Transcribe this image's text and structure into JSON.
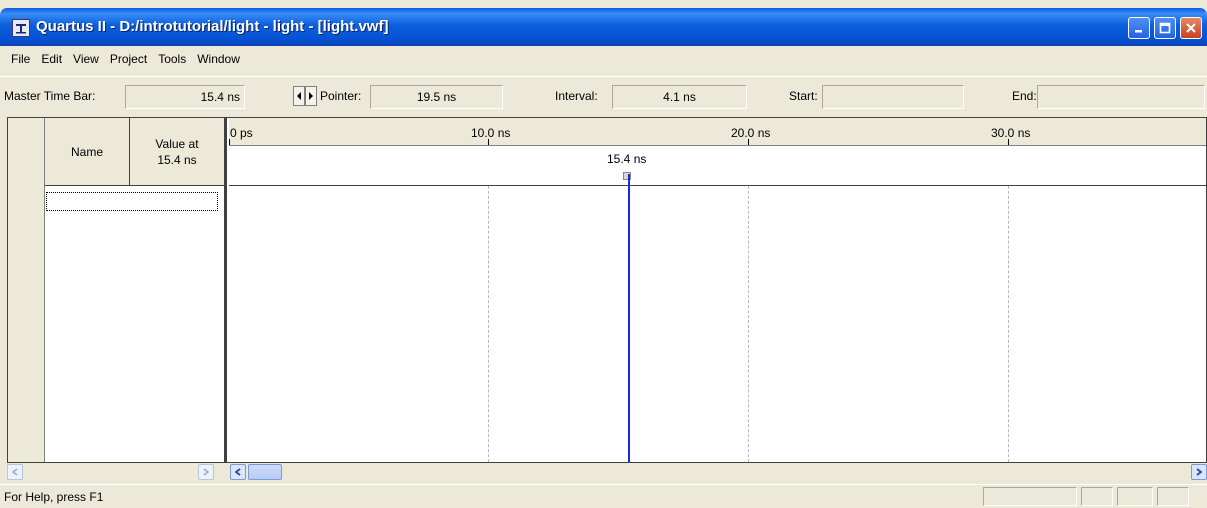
{
  "window": {
    "title": "Quartus II - D:/introtutorial/light - light - [light.vwf]"
  },
  "menu": [
    "File",
    "Edit",
    "View",
    "Project",
    "Tools",
    "Window"
  ],
  "timebar": {
    "master_label": "Master Time Bar:",
    "master_value": "15.4 ns",
    "pointer_label": "Pointer:",
    "pointer_value": "19.5 ns",
    "interval_label": "Interval:",
    "interval_value": "4.1 ns",
    "start_label": "Start:",
    "start_value": "",
    "end_label": "End:",
    "end_value": ""
  },
  "columns": {
    "name": "Name",
    "value_line1": "Value at",
    "value_line2": "15.4 ns"
  },
  "ruler": {
    "ticks": [
      "0 ps",
      "10.0 ns",
      "20.0 ns",
      "30.0 ns"
    ],
    "cursor_label": "15.4 ns"
  },
  "status": {
    "help_text": "For Help, press F1"
  }
}
